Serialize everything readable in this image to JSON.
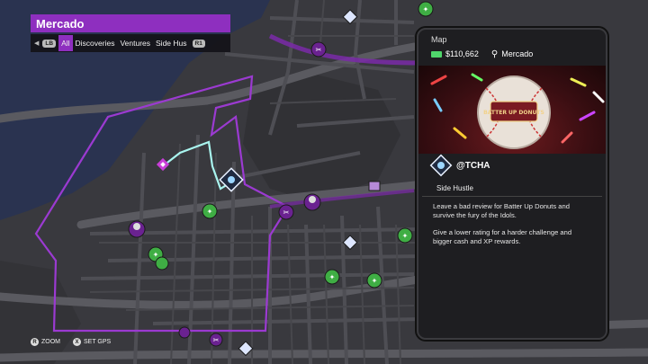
{
  "header": {
    "region": "Mercado",
    "lb": "LB",
    "rb": "R1",
    "filters": [
      "All",
      "Discoveries",
      "Ventures",
      "Side Hus"
    ]
  },
  "panel": {
    "title": "Map",
    "cash": "$110,662",
    "location": "Mercado",
    "gig_name": "@TCHA",
    "gig_type": "Side Hustle",
    "desc_1": "Leave a bad review for Batter Up Donuts and survive the fury of the Idols.",
    "desc_2": "Give a lower rating for a harder challenge and bigger cash and XP rewards.",
    "hero_logo_text": "BATTER UP DONUTS"
  },
  "footer": {
    "zoom_key": "R",
    "zoom_label": "ZOOM",
    "gps_key": "X",
    "gps_label": "SET GPS"
  },
  "colors": {
    "accent": "#8e2fbf",
    "boundary": "#9b3ad1",
    "route": "#a9f5ef",
    "water": "#2a3350",
    "land": "#3a3a3f",
    "road": "#55555a",
    "cash": "#4fd66b",
    "marker_green": "#3fae44"
  }
}
